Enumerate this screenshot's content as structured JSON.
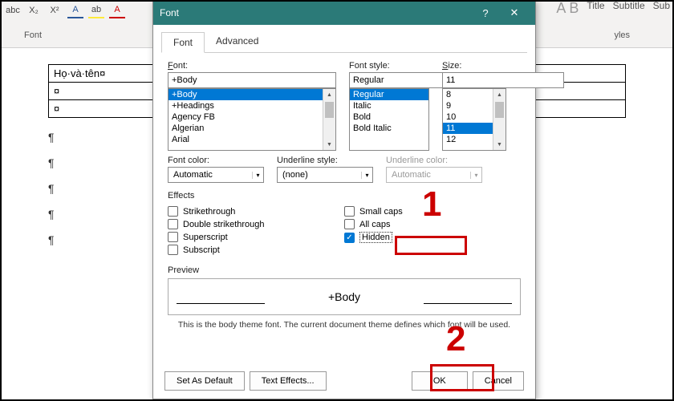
{
  "ribbon": {
    "group_font": "Font",
    "group_styles": "yles",
    "style_title": "Title",
    "style_subtitle": "Subtitle",
    "style_sub": "Sub"
  },
  "doc": {
    "cell_text": "Họ·và·tên¤",
    "cell_empty": "¤",
    "para": "¶"
  },
  "dialog": {
    "title": "Font",
    "tabs": {
      "font": "Font",
      "advanced": "Advanced"
    },
    "labels": {
      "font": "Font:",
      "style": "Font style:",
      "size": "Size:",
      "color": "Font color:",
      "ustyle": "Underline style:",
      "ucolor": "Underline color:",
      "effects": "Effects",
      "preview": "Preview"
    },
    "font_value": "+Body",
    "font_list": [
      "+Body",
      "+Headings",
      "Agency FB",
      "Algerian",
      "Arial"
    ],
    "style_value": "Regular",
    "style_list": [
      "Regular",
      "Italic",
      "Bold",
      "Bold Italic"
    ],
    "size_value": "11",
    "size_list": [
      "8",
      "9",
      "10",
      "11",
      "12"
    ],
    "color_value": "Automatic",
    "ustyle_value": "(none)",
    "ucolor_value": "Automatic",
    "effects": {
      "strike": "Strikethrough",
      "dstrike": "Double strikethrough",
      "sup": "Superscript",
      "sub": "Subscript",
      "smallcaps": "Small caps",
      "allcaps": "All caps",
      "hidden": "Hidden"
    },
    "preview_text": "+Body",
    "preview_note": "This is the body theme font. The current document theme defines which font will be used.",
    "buttons": {
      "default": "Set As Default",
      "texteff": "Text Effects...",
      "ok": "OK",
      "cancel": "Cancel"
    }
  },
  "callouts": {
    "n1": "1",
    "n2": "2"
  }
}
